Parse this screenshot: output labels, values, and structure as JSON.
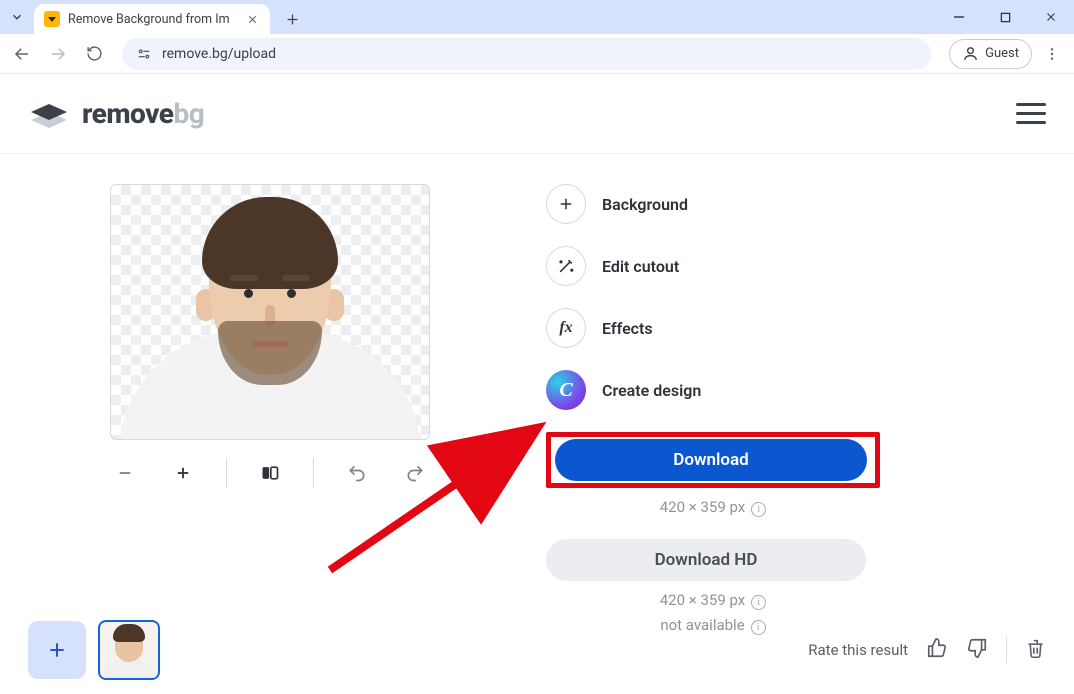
{
  "browser": {
    "tab_title": "Remove Background from Im",
    "url": "remove.bg/upload",
    "guest_label": "Guest"
  },
  "header": {
    "logo_remove": "remove",
    "logo_bg": "bg"
  },
  "options": {
    "background": "Background",
    "edit_cutout": "Edit cutout",
    "effects": "Effects",
    "create_design": "Create design"
  },
  "download": {
    "primary_label": "Download",
    "primary_dimensions": "420 × 359 px",
    "hd_label": "Download HD",
    "hd_dimensions": "420 × 359 px",
    "hd_not_available": "not available"
  },
  "rate": {
    "label": "Rate this result"
  }
}
